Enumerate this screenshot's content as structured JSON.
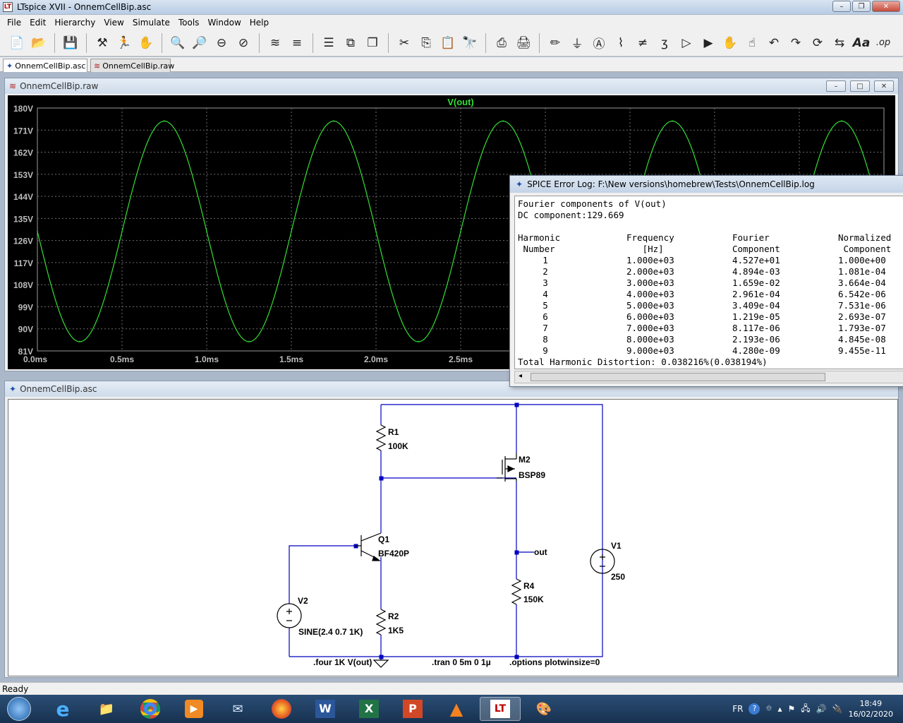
{
  "window": {
    "title": "LTspice XVII - OnnemCellBip.asc"
  },
  "menu": [
    "File",
    "Edit",
    "Hierarchy",
    "View",
    "Simulate",
    "Tools",
    "Window",
    "Help"
  ],
  "toolbar_icons": [
    "new-schematic-icon",
    "open-icon",
    "save-icon",
    "control-panel-icon",
    "run-icon",
    "halt-icon",
    "zoom-in-icon",
    "zoom-pan-icon",
    "zoom-out-icon",
    "zoom-cancel-icon",
    "autorange-icon",
    "visible-traces-icon",
    "tile-horizontal-icon",
    "tile-vertical-icon",
    "cascade-icon",
    "cut-icon",
    "copy-icon",
    "paste-icon",
    "find-icon",
    "print-icon",
    "print-setup-icon",
    "draw-wire-icon",
    "ground-icon",
    "label-net-icon",
    "resistor-icon",
    "capacitor-icon",
    "inductor-icon",
    "diode-icon",
    "component-icon",
    "move-icon",
    "drag-icon",
    "undo-icon",
    "redo-icon",
    "rotate-icon",
    "mirror-icon",
    "text-icon",
    "spice-directive-icon"
  ],
  "tabs": [
    {
      "label": "OnnemCellBip.asc",
      "icon": "schematic-icon",
      "active": true
    },
    {
      "label": "OnnemCellBip.raw",
      "icon": "waveform-icon",
      "active": false
    }
  ],
  "wave_window": {
    "title": "OnnemCellBip.raw"
  },
  "schem_window": {
    "title": "OnnemCellBip.asc"
  },
  "chart_data": {
    "type": "line",
    "title": "V(out)",
    "xlabel": "",
    "ylabel": "",
    "xlim": [
      0,
      5
    ],
    "ylim": [
      81,
      180
    ],
    "x_unit": "ms",
    "y_unit": "V",
    "xticks": [
      "0.0ms",
      "0.5ms",
      "1.0ms",
      "1.5ms",
      "2.0ms",
      "2.5ms"
    ],
    "yticks": [
      "180V",
      "171V",
      "162V",
      "153V",
      "144V",
      "135V",
      "126V",
      "117V",
      "108V",
      "99V",
      "90V",
      "81V"
    ],
    "grid": true,
    "series": [
      {
        "name": "V(out)",
        "color": "#33dd33",
        "x": [
          0.0,
          0.25,
          0.5,
          0.75,
          1.0,
          1.25,
          1.5,
          1.75,
          2.0,
          2.25,
          2.5,
          2.75,
          3.0,
          3.25,
          3.5,
          3.75,
          4.0,
          4.25,
          4.5,
          4.75,
          5.0
        ],
        "y": [
          129.7,
          84.9,
          129.7,
          174.8,
          129.7,
          84.9,
          129.7,
          174.8,
          129.7,
          84.9,
          129.7,
          174.8,
          129.7,
          84.9,
          129.7,
          174.8,
          129.7,
          84.9,
          129.7,
          174.8,
          129.7
        ]
      }
    ]
  },
  "spice_log": {
    "title": "SPICE Error Log: F:\\New versions\\homebrew\\Tests\\OnnemCellBip.log",
    "line1": "Fourier components of V(out)",
    "line2": "DC component:129.669",
    "headers": [
      [
        "Harmonic",
        "Frequency",
        "Fourier",
        "Normalized"
      ],
      [
        " Number",
        "   [Hz]",
        "Component",
        " Component"
      ]
    ],
    "rows": [
      [
        "1",
        "1.000e+03",
        "4.527e+01",
        "1.000e+00"
      ],
      [
        "2",
        "2.000e+03",
        "4.894e-03",
        "1.081e-04"
      ],
      [
        "3",
        "3.000e+03",
        "1.659e-02",
        "3.664e-04"
      ],
      [
        "4",
        "4.000e+03",
        "2.961e-04",
        "6.542e-06"
      ],
      [
        "5",
        "5.000e+03",
        "3.409e-04",
        "7.531e-06"
      ],
      [
        "6",
        "6.000e+03",
        "1.219e-05",
        "2.693e-07"
      ],
      [
        "7",
        "7.000e+03",
        "8.117e-06",
        "1.793e-07"
      ],
      [
        "8",
        "8.000e+03",
        "2.193e-06",
        "4.845e-08"
      ],
      [
        "9",
        "9.000e+03",
        "4.280e-09",
        "9.455e-11"
      ]
    ],
    "thd": "Total Harmonic Distortion: 0.038216%(0.038194%)"
  },
  "schematic": {
    "r1_name": "R1",
    "r1_value": "100K",
    "m2_name": "M2",
    "m2_value": "BSP89",
    "q1_name": "Q1",
    "q1_value": "BF420P",
    "r2_name": "R2",
    "r2_value": "1K5",
    "r4_name": "R4",
    "r4_value": "150K",
    "v1_name": "V1",
    "v1_value": "250",
    "v2_name": "V2",
    "v2_value": "SINE(2.4 0.7 1K)",
    "out_label": "out",
    "dir_four": ".four 1K V(out)",
    "dir_tran": ".tran 0 5m 0 1µ",
    "dir_options": ".options plotwinsize=0"
  },
  "status": "Ready",
  "taskbar": {
    "lang": "FR",
    "time": "18:49",
    "date": "16/02/2020",
    "apps": [
      "start-orb-icon",
      "internet-explorer-icon",
      "file-explorer-icon",
      "chrome-icon",
      "media-player-icon",
      "thunderbird-icon",
      "firefox-icon",
      "word-icon",
      "excel-icon",
      "powerpoint-icon",
      "vlc-icon",
      "ltspice-icon",
      "paint-icon"
    ]
  }
}
